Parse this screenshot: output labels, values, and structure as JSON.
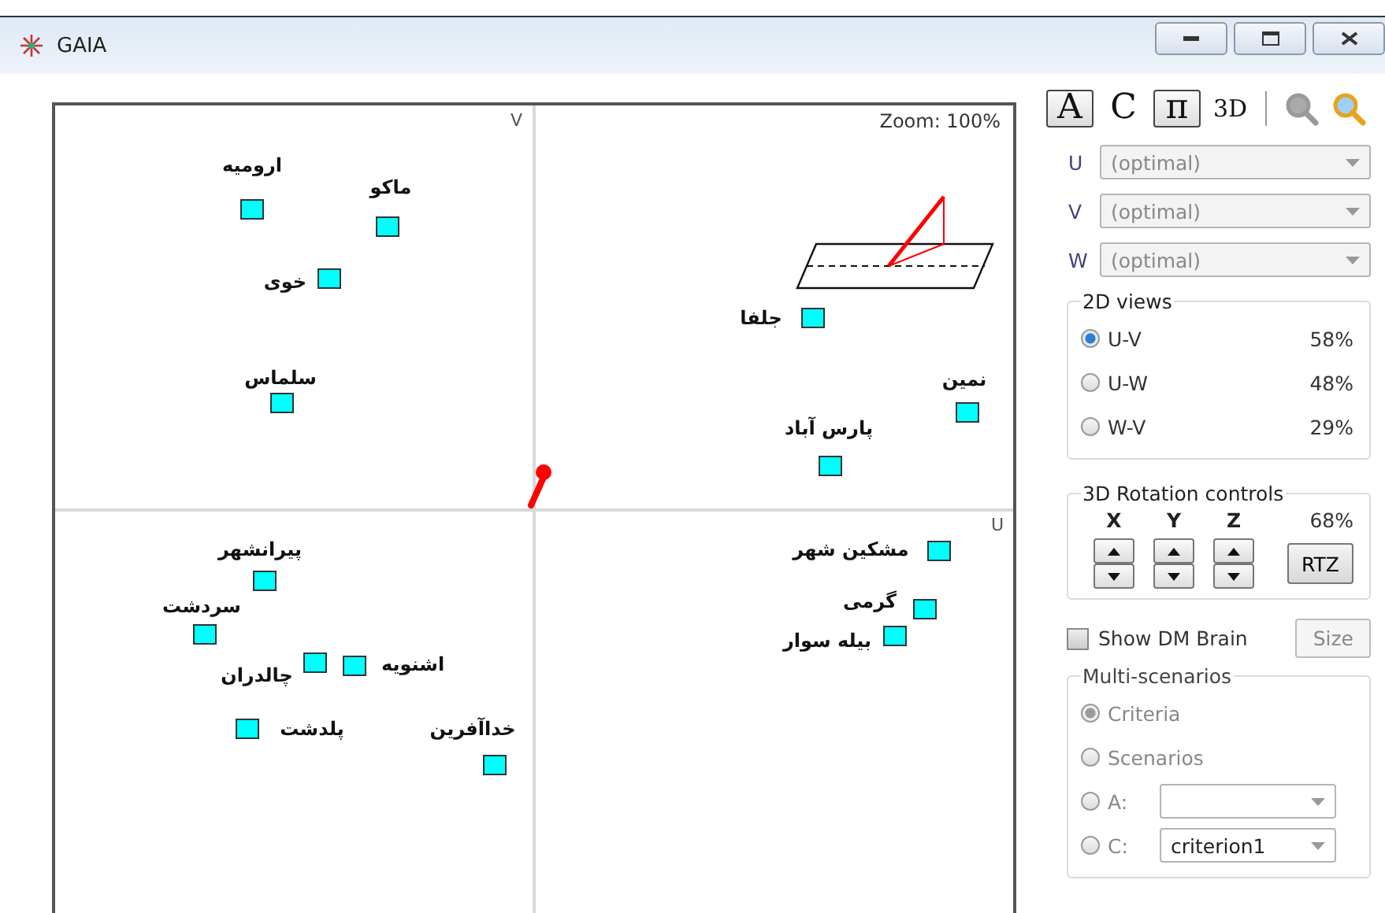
{
  "window": {
    "title": "GAIA"
  },
  "plot": {
    "zoom_label": "Zoom: 100%",
    "axis_v": "V",
    "axis_u": "U",
    "points": [
      {
        "label": "ارومیه"
      },
      {
        "label": "ماکو"
      },
      {
        "label": "خوی"
      },
      {
        "label": "سلماس"
      },
      {
        "label": "جلفا"
      },
      {
        "label": "نمین"
      },
      {
        "label": "پارس آباد"
      },
      {
        "label": "پیرانشهر"
      },
      {
        "label": "سردشت"
      },
      {
        "label": "اشنویه"
      },
      {
        "label": "چالدران"
      },
      {
        "label": "پلدشت"
      },
      {
        "label": "خداآفرین"
      },
      {
        "label": "مشکین شهر"
      },
      {
        "label": "گرمی"
      },
      {
        "label": "بیله سوار"
      }
    ]
  },
  "toolbar": {
    "alternatives_toggle": {
      "label": "A",
      "selected": true
    },
    "criteria_toggle": {
      "label": "C",
      "selected": false
    },
    "pi_toggle": {
      "label": "π",
      "selected": true
    },
    "view_3d_toggle": {
      "label": "3D",
      "selected": false
    },
    "zoom_tool": {
      "disabled": true
    },
    "zoom_fit_tool": {
      "disabled": false
    }
  },
  "axis_selectors": [
    {
      "label": "U",
      "value": "(optimal)",
      "disabled": true
    },
    {
      "label": "V",
      "value": "(optimal)",
      "disabled": true
    },
    {
      "label": "W",
      "value": "(optimal)",
      "disabled": true
    }
  ],
  "views_2d": {
    "title": "2D views",
    "options": [
      {
        "label": "U-V",
        "percent": "58%",
        "selected": true
      },
      {
        "label": "U-W",
        "percent": "48%",
        "selected": false
      },
      {
        "label": "W-V",
        "percent": "29%",
        "selected": false
      }
    ]
  },
  "rotation": {
    "title": "3D Rotation controls",
    "axis_x": "X",
    "axis_y": "Y",
    "axis_z": "Z",
    "percent": "68%",
    "reset_button": "RTZ"
  },
  "show_dm_brain": {
    "label": "Show DM Brain",
    "checked": false
  },
  "size_button": {
    "label": "Size",
    "disabled": true
  },
  "multi_scenarios": {
    "title": "Multi-scenarios",
    "disabled": true,
    "options": [
      {
        "kind": "radio",
        "label": "Criteria",
        "selected": true
      },
      {
        "kind": "radio",
        "label": "Scenarios",
        "selected": false
      },
      {
        "kind": "combo",
        "label": "A:",
        "selected": false
      },
      {
        "kind": "combo",
        "label": "C:",
        "value": "criterion1",
        "selected": false
      }
    ]
  }
}
